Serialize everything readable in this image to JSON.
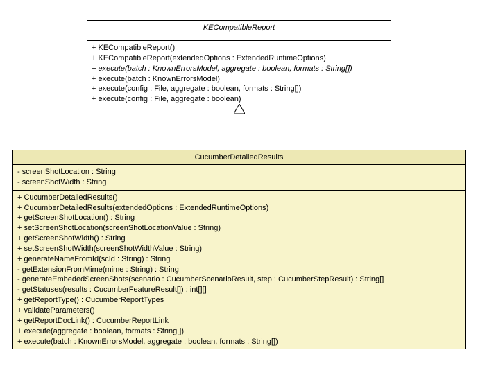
{
  "parent": {
    "name": "KECompatibleReport",
    "abstract": true,
    "attributes": [],
    "methods": [
      {
        "text": "+ KECompatibleReport()",
        "abstract": false
      },
      {
        "text": "+ KECompatibleReport(extendedOptions : ExtendedRuntimeOptions)",
        "abstract": false
      },
      {
        "text": "+ execute(batch : KnownErrorsModel, aggregate : boolean, formats : String[])",
        "abstract": true
      },
      {
        "text": "+ execute(batch : KnownErrorsModel)",
        "abstract": false
      },
      {
        "text": "+ execute(config : File, aggregate : boolean, formats : String[])",
        "abstract": false
      },
      {
        "text": "+ execute(config : File, aggregate : boolean)",
        "abstract": false
      }
    ]
  },
  "child": {
    "name": "CucumberDetailedResults",
    "abstract": false,
    "attributes": [
      {
        "text": "- screenShotLocation : String"
      },
      {
        "text": "- screenShotWidth : String"
      }
    ],
    "methods": [
      {
        "text": "+ CucumberDetailedResults()",
        "abstract": false
      },
      {
        "text": "+ CucumberDetailedResults(extendedOptions : ExtendedRuntimeOptions)",
        "abstract": false
      },
      {
        "text": "+ getScreenShotLocation() : String",
        "abstract": false
      },
      {
        "text": "+ setScreenShotLocation(screenShotLocationValue : String)",
        "abstract": false
      },
      {
        "text": "+ getScreenShotWidth() : String",
        "abstract": false
      },
      {
        "text": "+ setScreenShotWidth(screenShotWidthValue : String)",
        "abstract": false
      },
      {
        "text": "+ generateNameFromId(scId : String) : String",
        "abstract": false
      },
      {
        "text": "- getExtensionFromMime(mime : String) : String",
        "abstract": false
      },
      {
        "text": "- generateEmbededScreenShots(scenario : CucumberScenarioResult, step : CucumberStepResult) : String[]",
        "abstract": false
      },
      {
        "text": "- getStatuses(results : CucumberFeatureResult[]) : int[][]",
        "abstract": false
      },
      {
        "text": "+ getReportType() : CucumberReportTypes",
        "abstract": false
      },
      {
        "text": "+ validateParameters()",
        "abstract": false
      },
      {
        "text": "+ getReportDocLink() : CucumberReportLink",
        "abstract": false
      },
      {
        "text": "+ execute(aggregate : boolean, formats : String[])",
        "abstract": false
      },
      {
        "text": "+ execute(batch : KnownErrorsModel, aggregate : boolean, formats : String[])",
        "abstract": false
      }
    ]
  }
}
